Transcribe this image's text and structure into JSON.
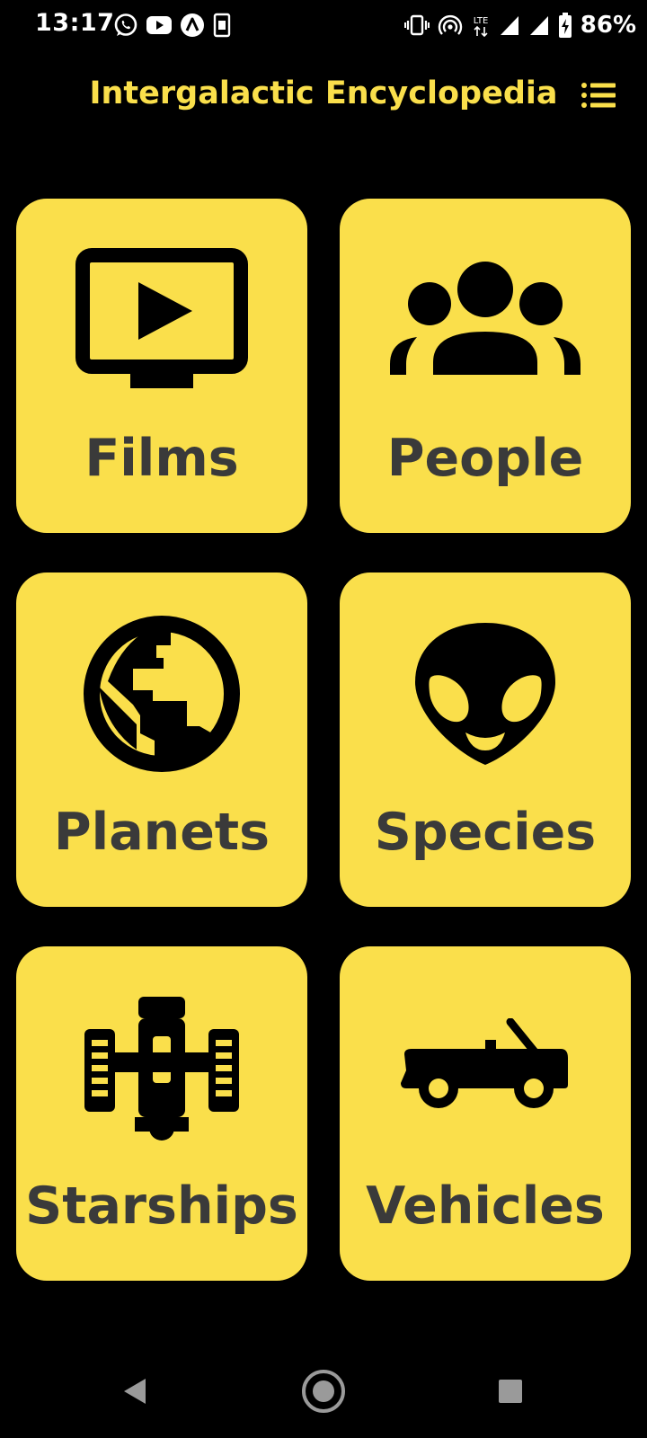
{
  "status_bar": {
    "time": "13:17",
    "battery_percent": "86%",
    "network_label": "LTE",
    "left_icons": [
      "whatsapp-icon",
      "youtube-icon",
      "app-icon",
      "sim-card-icon"
    ],
    "right_icons": [
      "vibrate-icon",
      "hotspot-icon",
      "lte-icon",
      "signal-icon",
      "signal-icon",
      "battery-charging-icon"
    ]
  },
  "app_bar": {
    "title": "Intergalactic Encyclopedia",
    "menu_icon": "list-icon"
  },
  "categories": [
    {
      "label": "Films",
      "icon": "tv-play-icon"
    },
    {
      "label": "People",
      "icon": "people-group-icon"
    },
    {
      "label": "Planets",
      "icon": "globe-icon"
    },
    {
      "label": "Species",
      "icon": "alien-icon"
    },
    {
      "label": "Starships",
      "icon": "starship-icon"
    },
    {
      "label": "Vehicles",
      "icon": "car-icon"
    }
  ],
  "nav_bar": {
    "icons": [
      "back-icon",
      "home-icon",
      "recents-icon"
    ]
  },
  "colors": {
    "background": "#000000",
    "accent": "#fadf4b",
    "card_text": "#3a3a3a"
  }
}
